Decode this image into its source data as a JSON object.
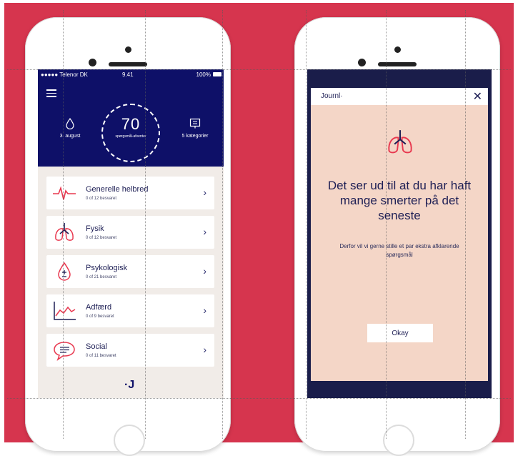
{
  "left_phone": {
    "status": {
      "carrier": "●●●●● Telenor DK",
      "time": "9.41",
      "battery": "100%"
    },
    "header": {
      "date_label": "3. august",
      "score": "70",
      "score_caption": "spørgsmål-afventer",
      "categories_label": "5 kategorier"
    },
    "categories": [
      {
        "title": "Generelle helbred",
        "subtitle": "0 of 12 besvaret"
      },
      {
        "title": "Fysik",
        "subtitle": "0 of 12 besvaret"
      },
      {
        "title": "Psykologisk",
        "subtitle": "0 of 21 besvaret"
      },
      {
        "title": "Adfærd",
        "subtitle": "0 of 9 besvaret"
      },
      {
        "title": "Social",
        "subtitle": "0 of 11 besvaret"
      }
    ],
    "footer_logo": "·J"
  },
  "right_phone": {
    "logo": "Journl·",
    "close_symbol": "✕",
    "headline": "Det ser ud til at du har haft mange smerter på det seneste",
    "subtext": "Derfor vil vi gerne stille et par ekstra afklarende spørgsmål",
    "button_label": "Okay"
  },
  "colors": {
    "background": "#d6354e",
    "navy": "#0e1068",
    "accent": "#e8384f",
    "modal_bg": "#f4d6c7"
  }
}
